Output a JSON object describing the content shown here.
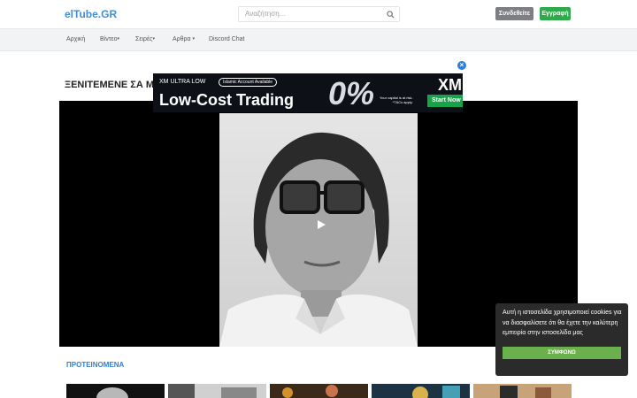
{
  "header": {
    "logo": "elTube.GR",
    "search_placeholder": "Αναζήτηση...",
    "login_label": "Συνδεθείτε",
    "register_label": "Εγγραφή",
    "accent_color": "#3f8fd6",
    "login_color": "#7d7f82",
    "register_color": "#2faa4a"
  },
  "nav": {
    "items": [
      {
        "label": "Αρχική"
      },
      {
        "label": "Βίντεο"
      },
      {
        "label": "Σειρές"
      },
      {
        "label": "Αρθρα"
      },
      {
        "label": "Discord Chat"
      }
    ]
  },
  "page": {
    "title": "ΞΕΝΙΤΕΜΕΝΕ ΣΑ ΜΑ",
    "recommended_label": "ΠΡΟΤΕΙΝΟΜΕΝΑ"
  },
  "ad": {
    "brand": "XM ULTRA LOW",
    "badge": "Islamic Account Available",
    "headline": "Low-Cost Trading",
    "big_figure": "0%",
    "risk_line1": "Your capital is at risk.",
    "risk_line2": "*T&Cs apply.",
    "logo": "XM",
    "cta": "Start Now",
    "close_icon": "close-icon"
  },
  "player": {
    "play_icon": "play-icon",
    "background": "#000000"
  },
  "cookie": {
    "text": "Αυτή η ιστοσελίδα χρησιμοποιεί cookies για να διασφαλίσετε ότι θα έχετε την καλύτερη εμπειρία στην ιστοσελίδα μας",
    "accept_label": "ΣΥΜΦΩΝΩ",
    "accept_color": "#6ab04c"
  },
  "thumbnails": [
    {
      "name": "thumb-1"
    },
    {
      "name": "thumb-2"
    },
    {
      "name": "thumb-3"
    },
    {
      "name": "thumb-4"
    },
    {
      "name": "thumb-5"
    }
  ]
}
